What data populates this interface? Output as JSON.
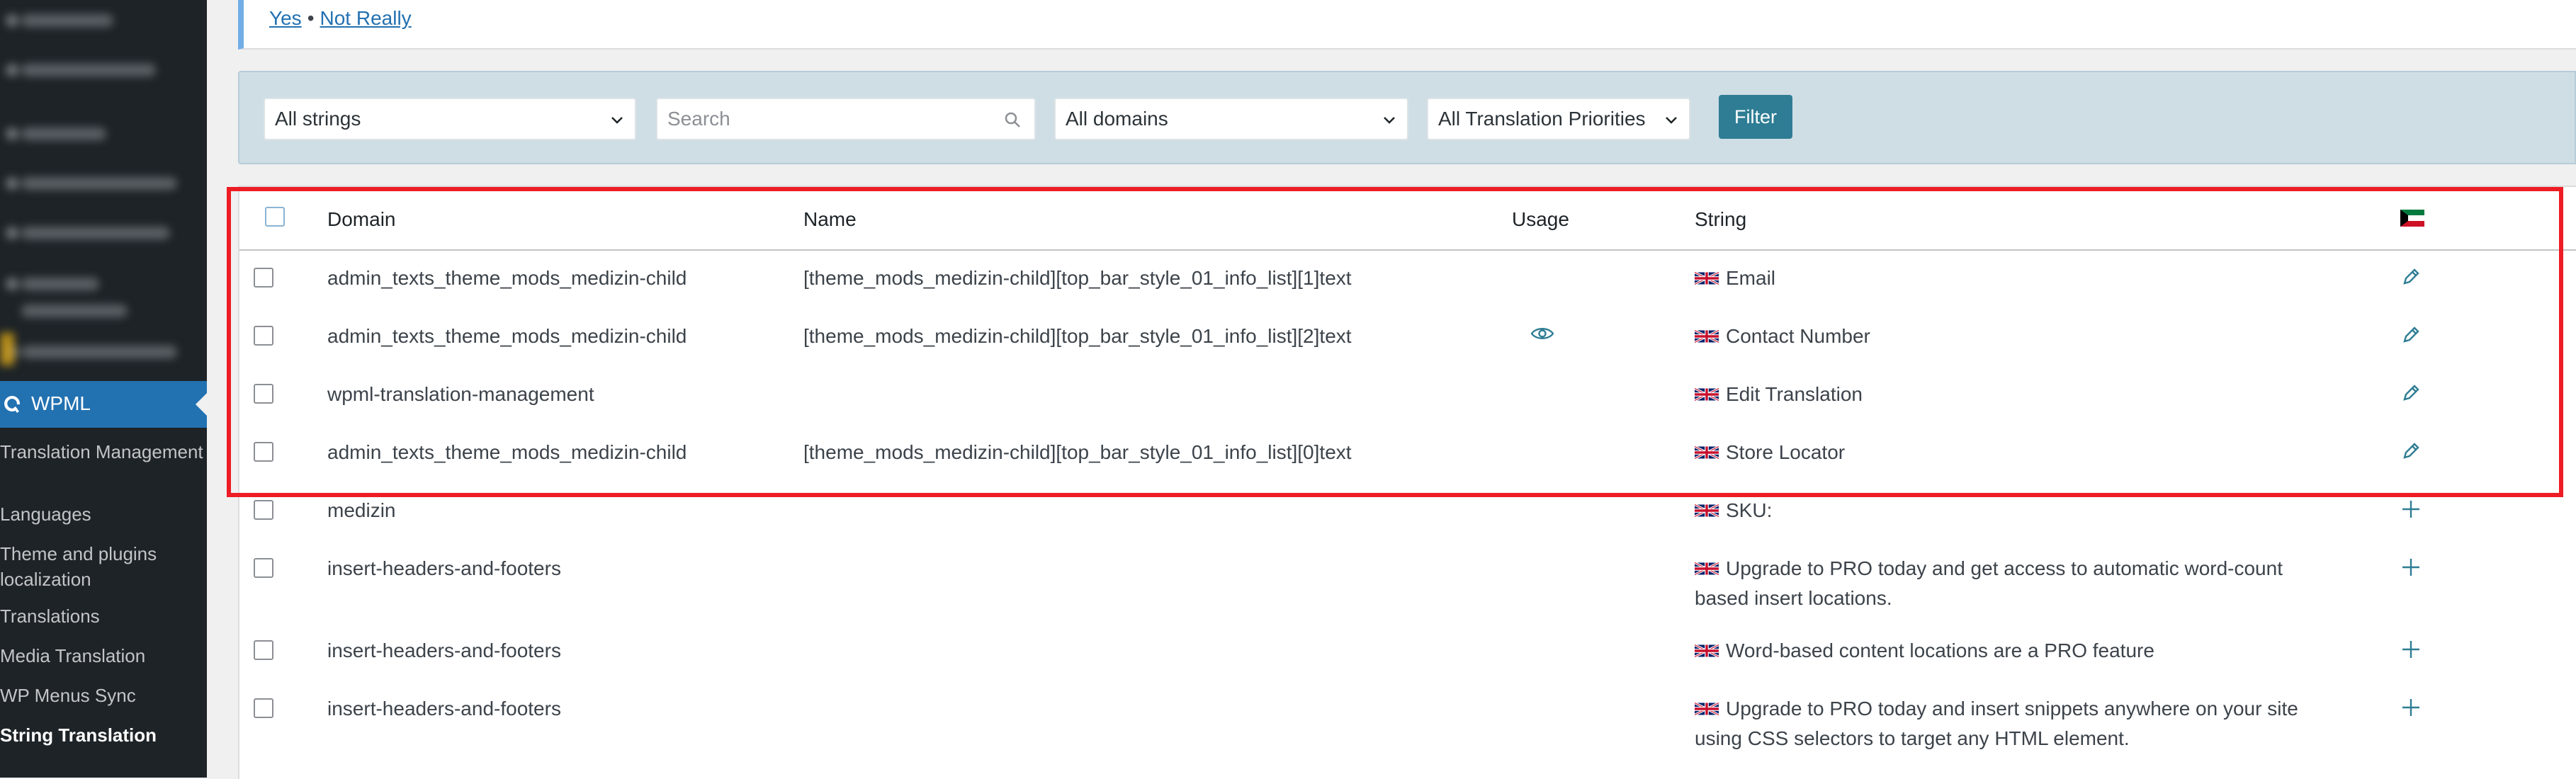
{
  "notice": {
    "yes_label": "Yes",
    "separator": "•",
    "no_label": "Not Really"
  },
  "sidebar": {
    "wpml_label": "WPML",
    "submenu": [
      {
        "label": "Translation Management"
      },
      {
        "label": "Languages"
      },
      {
        "label": "Theme and plugins localization"
      },
      {
        "label": "Translations"
      },
      {
        "label": "Media Translation"
      },
      {
        "label": "WP Menus Sync"
      },
      {
        "label": "String Translation",
        "current": true
      }
    ]
  },
  "filters": {
    "strings_select": "All strings",
    "search_placeholder": "Search",
    "domains_select": "All domains",
    "priorities_select": "All Translation Priorities",
    "filter_button": "Filter"
  },
  "table": {
    "headers": {
      "domain": "Domain",
      "name": "Name",
      "usage": "Usage",
      "string": "String"
    },
    "rows": [
      {
        "domain": "admin_texts_theme_mods_medizin-child",
        "name": "[theme_mods_medizin-child][top_bar_style_01_info_list][1]text",
        "usage": false,
        "string": "Email",
        "action": "edit"
      },
      {
        "domain": "admin_texts_theme_mods_medizin-child",
        "name": "[theme_mods_medizin-child][top_bar_style_01_info_list][2]text",
        "usage": true,
        "string": "Contact Number",
        "action": "edit"
      },
      {
        "domain": "wpml-translation-management",
        "name": "",
        "usage": false,
        "string": "Edit Translation",
        "action": "edit"
      },
      {
        "domain": "admin_texts_theme_mods_medizin-child",
        "name": "[theme_mods_medizin-child][top_bar_style_01_info_list][0]text",
        "usage": false,
        "string": "Store Locator",
        "action": "edit"
      },
      {
        "domain": "medizin",
        "name": "",
        "usage": false,
        "string": "SKU:",
        "action": "add"
      },
      {
        "domain": "insert-headers-and-footers",
        "name": "",
        "usage": false,
        "string": "Upgrade to PRO today and get access to automatic word-count based insert locations.",
        "action": "add"
      },
      {
        "domain": "insert-headers-and-footers",
        "name": "",
        "usage": false,
        "string": "Word-based content locations are a PRO feature",
        "action": "add"
      },
      {
        "domain": "insert-headers-and-footers",
        "name": "",
        "usage": false,
        "string": "Upgrade to PRO today and insert snippets anywhere on your site using CSS selectors to target any HTML element.",
        "action": "add"
      }
    ]
  },
  "colors": {
    "accent": "#2271b1",
    "filter_button": "#2e7d94",
    "highlight": "#ee1c24",
    "sidebar": "#1d2327"
  }
}
